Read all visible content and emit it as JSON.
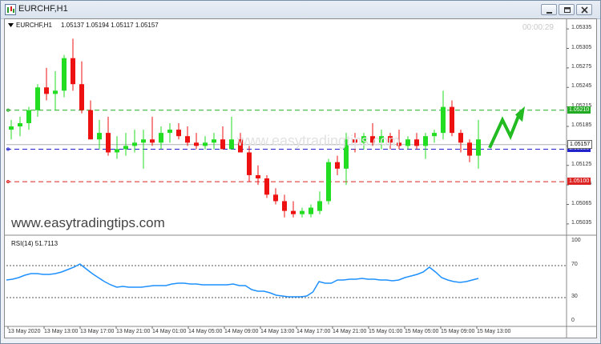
{
  "window": {
    "title": "EURCHF,H1"
  },
  "chart_header": {
    "symbol": "EURCHF,H1",
    "ohlc": "1.05137 1.05194 1.05117 1.05157"
  },
  "countdown": "00:00:29",
  "watermark": "www.easytradingtips.com",
  "watermark_faint": "www.easytradingtips.com",
  "rsi_label": "RSI(14) 51.7113",
  "colors": {
    "bull": "#22dd22",
    "bear": "#ee1111",
    "green_line": "#22aa22",
    "blue_line": "#2222cc",
    "red_line": "#dd2222",
    "rsi": "#1e90ff"
  },
  "price_axis": [
    "1.05335",
    "1.05305",
    "1.05275",
    "1.05245",
    "1.05215",
    "1.05185",
    "1.05155",
    "1.05125",
    "1.05095",
    "1.05065",
    "1.05035"
  ],
  "levels": [
    {
      "name": "green-level",
      "value": 1.0521,
      "label": "1.05210"
    },
    {
      "name": "blue-level",
      "value": 1.0515,
      "label": "1.05150"
    },
    {
      "name": "red-level",
      "value": 1.051,
      "label": "1.05100"
    }
  ],
  "current_price_label": "1.05157",
  "current_price_value": 1.05157,
  "rsi_axis": [
    "100",
    "70",
    "30",
    "0"
  ],
  "time_axis": [
    "13 May 2020",
    "13 May 13:00",
    "13 May 17:00",
    "13 May 21:00",
    "14 May 01:00",
    "14 May 05:00",
    "14 May 09:00",
    "14 May 13:00",
    "14 May 17:00",
    "14 May 21:00",
    "15 May 01:00",
    "15 May 05:00",
    "15 May 09:00",
    "15 May 13:00"
  ],
  "chart_data": {
    "type": "candlestick",
    "ylim": [
      1.05025,
      1.05345
    ],
    "rsi_levels": [
      70,
      30
    ],
    "candles": [
      [
        1.0518,
        1.05195,
        1.05165,
        1.05185
      ],
      [
        1.05185,
        1.052,
        1.0517,
        1.0519
      ],
      [
        1.0519,
        1.05215,
        1.0518,
        1.0521
      ],
      [
        1.0521,
        1.0525,
        1.052,
        1.05245
      ],
      [
        1.05245,
        1.05275,
        1.05225,
        1.05235
      ],
      [
        1.05235,
        1.0527,
        1.0521,
        1.0524
      ],
      [
        1.0524,
        1.05295,
        1.0523,
        1.0529
      ],
      [
        1.0529,
        1.0532,
        1.0524,
        1.0525
      ],
      [
        1.0525,
        1.05285,
        1.05205,
        1.0521
      ],
      [
        1.0521,
        1.05225,
        1.05165,
        1.05165
      ],
      [
        1.05165,
        1.05195,
        1.0515,
        1.05175
      ],
      [
        1.05175,
        1.052,
        1.0514,
        1.05145
      ],
      [
        1.05145,
        1.0517,
        1.05135,
        1.0515
      ],
      [
        1.0515,
        1.05175,
        1.0514,
        1.05155
      ],
      [
        1.05155,
        1.0518,
        1.05145,
        1.0516
      ],
      [
        1.0516,
        1.0518,
        1.0512,
        1.05165
      ],
      [
        1.05165,
        1.052,
        1.05155,
        1.0516
      ],
      [
        1.0516,
        1.05185,
        1.0515,
        1.05175
      ],
      [
        1.05175,
        1.0519,
        1.0516,
        1.0518
      ],
      [
        1.0518,
        1.0519,
        1.05165,
        1.0517
      ],
      [
        1.0517,
        1.05185,
        1.05155,
        1.0516
      ],
      [
        1.0516,
        1.05175,
        1.0515,
        1.05155
      ],
      [
        1.05155,
        1.0517,
        1.0515,
        1.0516
      ],
      [
        1.0516,
        1.05175,
        1.0515,
        1.05165
      ],
      [
        1.05165,
        1.05185,
        1.05155,
        1.0515
      ],
      [
        1.0515,
        1.052,
        1.0515,
        1.05165
      ],
      [
        1.05165,
        1.05175,
        1.0515,
        1.05145
      ],
      [
        1.05145,
        1.05155,
        1.051,
        1.0511
      ],
      [
        1.0511,
        1.05125,
        1.05095,
        1.05105
      ],
      [
        1.05105,
        1.0511,
        1.05075,
        1.0508
      ],
      [
        1.0508,
        1.0509,
        1.05065,
        1.0507
      ],
      [
        1.0507,
        1.0508,
        1.05045,
        1.05055
      ],
      [
        1.05055,
        1.0507,
        1.05045,
        1.0505
      ],
      [
        1.0505,
        1.0506,
        1.05045,
        1.05055
      ],
      [
        1.0505,
        1.05065,
        1.05045,
        1.0506
      ],
      [
        1.05055,
        1.05085,
        1.0505,
        1.0507
      ],
      [
        1.0507,
        1.05135,
        1.05065,
        1.0513
      ],
      [
        1.0513,
        1.0514,
        1.0511,
        1.0512
      ],
      [
        1.0512,
        1.05175,
        1.05095,
        1.05165
      ],
      [
        1.05165,
        1.05175,
        1.05145,
        1.0516
      ],
      [
        1.0516,
        1.05175,
        1.0515,
        1.0517
      ],
      [
        1.0517,
        1.0519,
        1.05155,
        1.0516
      ],
      [
        1.0516,
        1.0518,
        1.0515,
        1.0517
      ],
      [
        1.0517,
        1.05175,
        1.0515,
        1.0516
      ],
      [
        1.0516,
        1.0518,
        1.0515,
        1.05155
      ],
      [
        1.05155,
        1.0517,
        1.0515,
        1.05165
      ],
      [
        1.05165,
        1.05175,
        1.0515,
        1.05155
      ],
      [
        1.05155,
        1.05175,
        1.05135,
        1.0517
      ],
      [
        1.0517,
        1.0518,
        1.0516,
        1.05175
      ],
      [
        1.05175,
        1.0524,
        1.05165,
        1.05215
      ],
      [
        1.05215,
        1.05225,
        1.0517,
        1.05175
      ],
      [
        1.05175,
        1.0518,
        1.05145,
        1.0516
      ],
      [
        1.0516,
        1.05165,
        1.0513,
        1.0514
      ],
      [
        1.0514,
        1.05195,
        1.0512,
        1.05165
      ]
    ],
    "rsi": [
      52,
      53,
      55,
      58,
      60,
      60,
      59,
      59,
      60,
      62,
      65,
      68,
      72,
      66,
      60,
      55,
      50,
      46,
      43,
      44,
      43,
      43,
      43,
      44,
      45,
      45,
      45,
      47,
      48,
      48,
      47,
      47,
      46,
      46,
      46,
      46,
      46,
      47,
      45,
      45,
      40,
      38,
      38,
      36,
      33,
      32,
      31,
      31,
      31,
      32,
      37,
      50,
      48,
      48,
      52,
      52,
      53,
      53,
      54,
      53,
      53,
      52,
      52,
      51,
      52,
      55,
      57,
      59,
      62,
      68,
      62,
      55,
      52,
      50,
      49,
      50,
      52,
      54
    ]
  }
}
